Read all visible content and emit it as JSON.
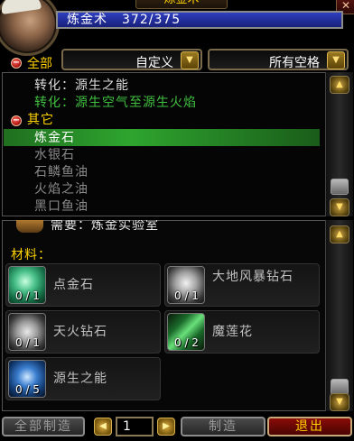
{
  "window": {
    "title": "炼金术",
    "close_label": "✕"
  },
  "skill": {
    "name": "炼金术",
    "value": "372/375",
    "fraction": 0.992
  },
  "filters": {
    "collapse_all_label": "全部",
    "subclass_value": "自定义",
    "slot_value": "所有空格"
  },
  "list": {
    "rows": [
      {
        "text": "转化：源生之能",
        "color": "#dcdcdc",
        "kind": "recipe"
      },
      {
        "text": "转化：源生空气至源生火焰",
        "color": "#40c040",
        "kind": "recipe"
      },
      {
        "text": "其它",
        "color": "#ffd200",
        "kind": "header"
      },
      {
        "text": "炼金石",
        "color": "#ffffff",
        "kind": "recipe-selected"
      },
      {
        "text": "水银石",
        "color": "#8a8a8a",
        "kind": "recipe"
      },
      {
        "text": "石鳞鱼油",
        "color": "#8a8a8a",
        "kind": "recipe"
      },
      {
        "text": "火焰之油",
        "color": "#8a8a8a",
        "kind": "recipe"
      },
      {
        "text": "黑口鱼油",
        "color": "#8a8a8a",
        "kind": "recipe"
      }
    ]
  },
  "detail": {
    "requires_text": "需要：炼金实验室",
    "materials_label": "材料：",
    "reagents": [
      {
        "name": "点金石",
        "count": "0 / 1",
        "icon": "philosopher-stone-icon"
      },
      {
        "name": "大地风暴钻石",
        "count": "0 / 1",
        "icon": "earthstorm-diamond-icon"
      },
      {
        "name": "天火钻石",
        "count": "0 / 1",
        "icon": "skyfire-diamond-icon"
      },
      {
        "name": "魔莲花",
        "count": "0 / 2",
        "icon": "mana-thistle-icon"
      },
      {
        "name": "源生之能",
        "count": "0 / 5",
        "icon": "primal-might-icon"
      }
    ]
  },
  "bottom": {
    "create_all_label": "全部制造",
    "quantity": "1",
    "create_label": "制造",
    "exit_label": "退出"
  },
  "colors": {
    "accent_gold": "#ffd200",
    "skill_bar": "#2a37b0",
    "selected_row": "#2ea52e",
    "exit_button": "#8a0c08"
  }
}
